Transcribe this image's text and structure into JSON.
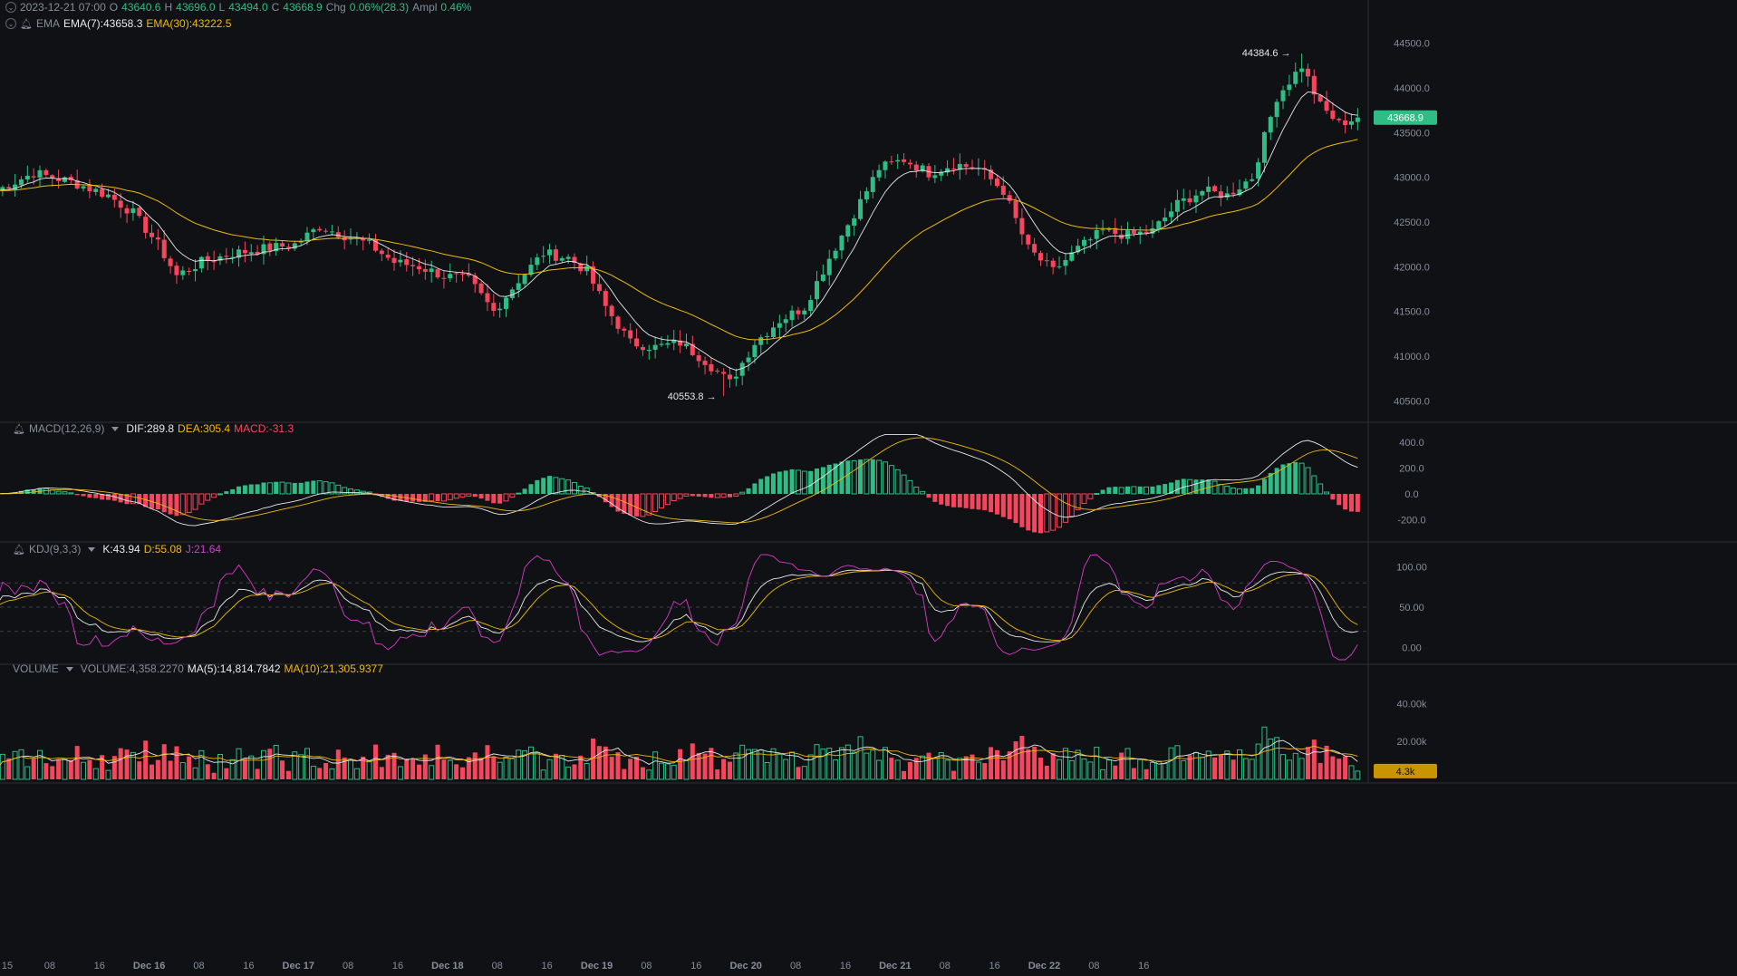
{
  "header": {
    "date": "2023-12-21 07:00",
    "o_label": "O",
    "o_value": "43640.6",
    "h_label": "H",
    "h_value": "43696.0",
    "l_label": "L",
    "l_value": "43494.0",
    "c_label": "C",
    "c_value": "43668.9",
    "chg_label": "Chg",
    "chg_value": "0.06%(28.3)",
    "ampl_label": "Ampl",
    "ampl_value": "0.46%"
  },
  "ema_legend": {
    "name": "EMA",
    "ema7": "EMA(7):43658.3",
    "ema30": "EMA(30):43222.5"
  },
  "macd_legend": {
    "name": "MACD(12,26,9)",
    "dif": "DIF:289.8",
    "dea": "DEA:305.4",
    "macd": "MACD:-31.3"
  },
  "kdj_legend": {
    "name": "KDJ(9,3,3)",
    "k": "K:43.94",
    "d": "D:55.08",
    "j": "J:21.64"
  },
  "vol_legend": {
    "name": "VOLUME",
    "volume": "VOLUME:4,358.2270",
    "ma5": "MA(5):14,814.7842",
    "ma10": "MA(10):21,305.9377"
  },
  "colors": {
    "up": "#2ebd85",
    "down": "#f6465d",
    "ema7": "#e6e8ea",
    "ema30": "#f0b90b",
    "j": "#d63bc8",
    "bg": "#101114",
    "grid": "#2b2f36"
  },
  "chart_data": {
    "type": "candlestick",
    "interval_hours": 1,
    "x_tick_labels": [
      "15",
      "08",
      "16",
      "Dec 16",
      "08",
      "16",
      "Dec 17",
      "08",
      "16",
      "Dec 18",
      "08",
      "16",
      "Dec 19",
      "08",
      "16",
      "Dec 20",
      "08",
      "16",
      "Dec 21",
      "08",
      "16",
      "Dec 22",
      "08",
      "16"
    ],
    "price_axis": {
      "ticks": [
        "44500.0",
        "44000.0",
        "43500.0",
        "43000.0",
        "42500.0",
        "42000.0",
        "41500.0",
        "41000.0",
        "40500.0"
      ],
      "range": [
        40300,
        44700
      ]
    },
    "last_price_label": "43668.9",
    "max_marker": "44384.6",
    "min_marker": "40553.8",
    "price_anchors": [
      [
        0,
        42850
      ],
      [
        6,
        43050
      ],
      [
        12,
        42950
      ],
      [
        18,
        42800
      ],
      [
        22,
        42600
      ],
      [
        26,
        42250
      ],
      [
        29,
        41900
      ],
      [
        33,
        42050
      ],
      [
        38,
        42150
      ],
      [
        43,
        42200
      ],
      [
        48,
        42250
      ],
      [
        52,
        42450
      ],
      [
        56,
        42350
      ],
      [
        60,
        42250
      ],
      [
        64,
        42050
      ],
      [
        68,
        42000
      ],
      [
        72,
        41900
      ],
      [
        76,
        41850
      ],
      [
        80,
        41500
      ],
      [
        84,
        41850
      ],
      [
        88,
        42150
      ],
      [
        92,
        42100
      ],
      [
        95,
        41950
      ],
      [
        98,
        41550
      ],
      [
        102,
        41150
      ],
      [
        106,
        41100
      ],
      [
        110,
        41150
      ],
      [
        114,
        40950
      ],
      [
        118,
        40700
      ],
      [
        122,
        41150
      ],
      [
        126,
        41400
      ],
      [
        130,
        41550
      ],
      [
        134,
        42100
      ],
      [
        138,
        42600
      ],
      [
        142,
        43100
      ],
      [
        146,
        43200
      ],
      [
        150,
        43050
      ],
      [
        154,
        43150
      ],
      [
        158,
        43100
      ],
      [
        162,
        42850
      ],
      [
        166,
        42200
      ],
      [
        170,
        41950
      ],
      [
        174,
        42200
      ],
      [
        178,
        42400
      ],
      [
        182,
        42350
      ],
      [
        186,
        42400
      ],
      [
        190,
        42700
      ],
      [
        194,
        42850
      ],
      [
        198,
        42800
      ],
      [
        202,
        43000
      ],
      [
        206,
        43900
      ],
      [
        210,
        44250
      ],
      [
        213,
        43800
      ],
      [
        216,
        43600
      ],
      [
        219,
        43668
      ]
    ],
    "candle_count": 220,
    "macd_axis": {
      "ticks": [
        "400.0",
        "200.0",
        "0.0",
        "-200.0"
      ],
      "range": [
        -330,
        470
      ]
    },
    "kdj_axis": {
      "ticks": [
        "100.00",
        "50.00",
        "0.00"
      ],
      "range": [
        -15,
        115
      ],
      "dashed_levels": [
        80,
        50,
        20
      ]
    },
    "volume_axis": {
      "ticks": [
        "40.00k",
        "20.00k"
      ],
      "range": [
        0,
        55000
      ]
    },
    "volume_last_label": "4.3k"
  }
}
